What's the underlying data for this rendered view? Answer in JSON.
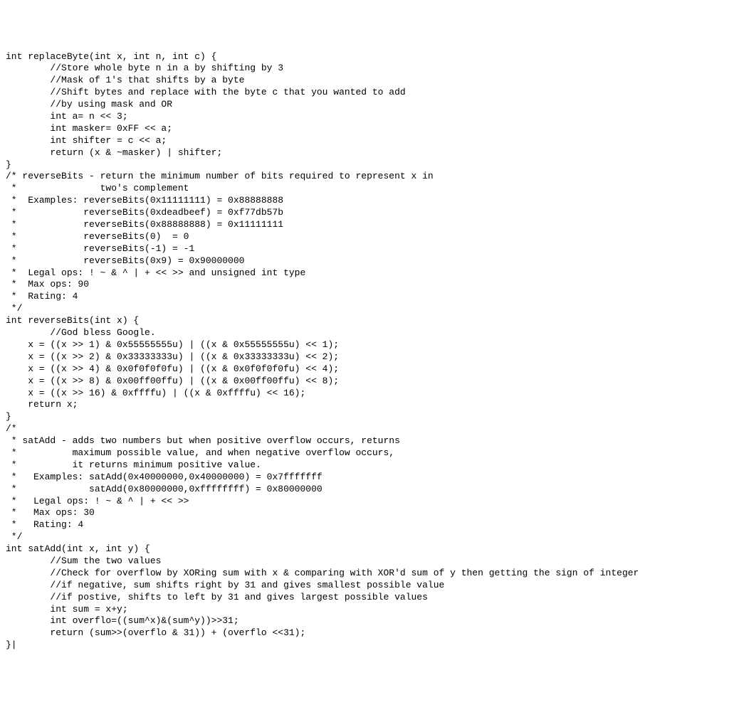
{
  "code_lines": [
    "int replaceByte(int x, int n, int c) {",
    "        //Store whole byte n in a by shifting by 3",
    "        //Mask of 1's that shifts by a byte",
    "        //Shift bytes and replace with the byte c that you wanted to add",
    "        //by using mask and OR",
    "        int a= n << 3;",
    "        int masker= 0xFF << a;",
    "        int shifter = c << a;",
    "        return (x & ~masker) | shifter;",
    "}",
    "/* reverseBits - return the minimum number of bits required to represent x in",
    " *               two's complement",
    " *  Examples: reverseBits(0x11111111) = 0x88888888",
    " *            reverseBits(0xdeadbeef) = 0xf77db57b",
    " *            reverseBits(0x88888888) = 0x11111111",
    " *            reverseBits(0)  = 0",
    " *            reverseBits(-1) = -1",
    " *            reverseBits(0x9) = 0x90000000",
    " *  Legal ops: ! ~ & ^ | + << >> and unsigned int type",
    " *  Max ops: 90",
    " *  Rating: 4",
    " */",
    "int reverseBits(int x) {",
    "        //God bless Google.",
    "    x = ((x >> 1) & 0x55555555u) | ((x & 0x55555555u) << 1);",
    "    x = ((x >> 2) & 0x33333333u) | ((x & 0x33333333u) << 2);",
    "    x = ((x >> 4) & 0x0f0f0f0fu) | ((x & 0x0f0f0f0fu) << 4);",
    "    x = ((x >> 8) & 0x00ff00ffu) | ((x & 0x00ff00ffu) << 8);",
    "    x = ((x >> 16) & 0xffffu) | ((x & 0xffffu) << 16);",
    "    return x;",
    "}",
    "/*",
    " * satAdd - adds two numbers but when positive overflow occurs, returns",
    " *          maximum possible value, and when negative overflow occurs,",
    " *          it returns minimum positive value.",
    " *   Examples: satAdd(0x40000000,0x40000000) = 0x7fffffff",
    " *             satAdd(0x80000000,0xffffffff) = 0x80000000",
    " *   Legal ops: ! ~ & ^ | + << >>",
    " *   Max ops: 30",
    " *   Rating: 4",
    " */",
    "int satAdd(int x, int y) {",
    "        //Sum the two values",
    "        //Check for overflow by XORing sum with x & comparing with XOR'd sum of y then getting the sign of integer",
    "        //if negative, sum shifts right by 31 and gives smallest possible value",
    "        //if postive, shifts to left by 31 and gives largest possible values",
    "        int sum = x+y;",
    "        int overflo=((sum^x)&(sum^y))>>31;",
    "        return (sum>>(overflo & 31)) + (overflo <<31);",
    "}|"
  ]
}
